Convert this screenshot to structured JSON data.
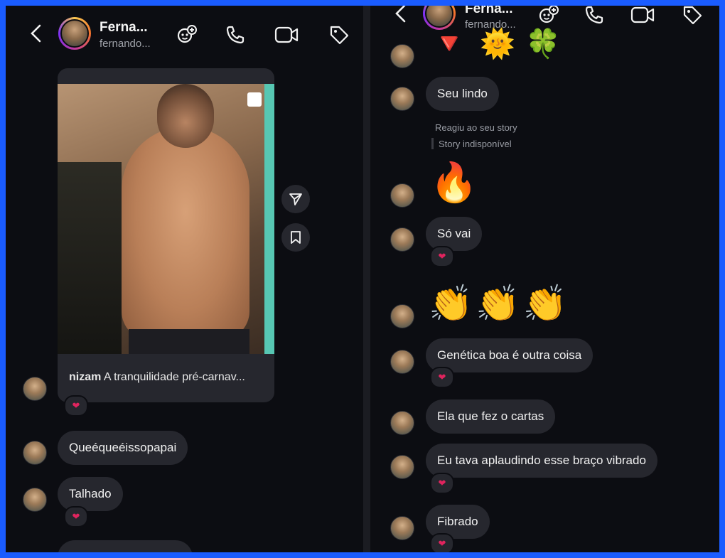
{
  "left": {
    "header": {
      "name": "Ferna...",
      "username": "fernando..."
    },
    "post": {
      "caption_user": "nizam",
      "caption_text": "A tranquilidade pré-carnav..."
    },
    "messages": [
      {
        "text": "Queéqueéissopapai"
      },
      {
        "text": "Talhado"
      }
    ]
  },
  "right": {
    "header": {
      "name": "Ferna...",
      "username": "fernando..."
    },
    "top_emojis": [
      "🔻",
      "🌞",
      "🍀"
    ],
    "messages": [
      {
        "text": "Seu lindo"
      },
      {
        "text": "Só vai"
      },
      {
        "text": "Genética boa é outra coisa"
      },
      {
        "text": "Ela que fez o cartas"
      },
      {
        "text": "Eu tava aplaudindo esse braço vibrado"
      },
      {
        "text": "Fibrado"
      }
    ],
    "story_reaction": {
      "label": "Reagiu ao seu story",
      "status": "Story indisponível"
    },
    "fire_emoji": "🔥",
    "clap_emojis": "👏👏👏"
  },
  "reaction": "❤",
  "colors": {
    "background": "#0c0d12",
    "bubble": "#26272e",
    "frame": "#1a5cff",
    "heart": "#e0245e"
  }
}
